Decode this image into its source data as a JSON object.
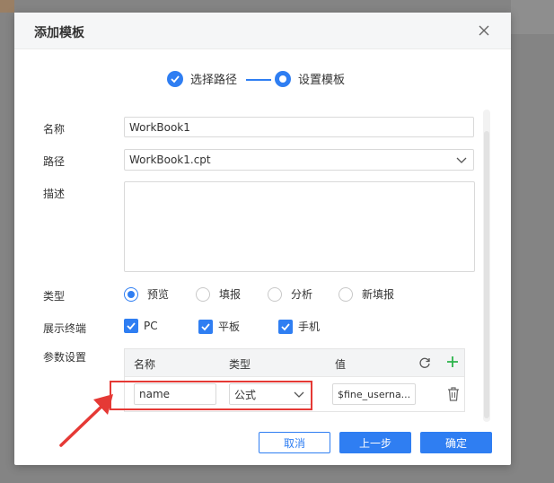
{
  "dialog": {
    "title": "添加模板",
    "steps": [
      {
        "label": "选择路径"
      },
      {
        "label": "设置模板"
      }
    ]
  },
  "form": {
    "name_label": "名称",
    "name_value": "WorkBook1",
    "path_label": "路径",
    "path_value": "WorkBook1.cpt",
    "desc_label": "描述",
    "desc_value": "",
    "type_label": "类型",
    "type_options": [
      "预览",
      "填报",
      "分析",
      "新填报"
    ],
    "type_selected": "预览",
    "terminal_label": "展示终端",
    "terminals": [
      "PC",
      "平板",
      "手机"
    ],
    "params_label": "参数设置"
  },
  "params_table": {
    "columns": [
      "名称",
      "类型",
      "值"
    ],
    "rows": [
      {
        "name": "name",
        "type": "公式",
        "value": "$fine_userna..."
      }
    ]
  },
  "buttons": {
    "cancel": "取消",
    "prev": "上一步",
    "ok": "确定"
  },
  "colors": {
    "accent": "#2f7ef2",
    "highlight": "#e53935"
  }
}
